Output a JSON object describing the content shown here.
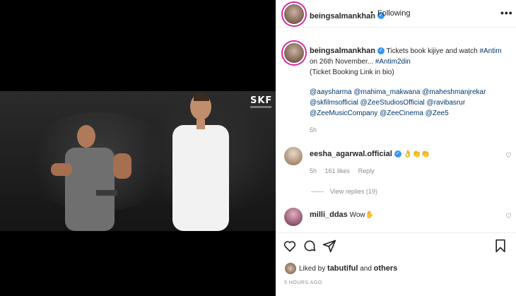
{
  "post": {
    "username": "beingsalmankhan",
    "following_label": "Following",
    "more_label": "•••",
    "caption_text": "Tickets book kijiye and watch ",
    "caption_tag1": "#Antim",
    "caption_mid": " on 26th November... ",
    "caption_tag2": "#Antim2din",
    "caption_line2": "(Ticket Booking Link in bio)",
    "mentions_line1": "@aaysharma @mahima_makwana @maheshmanjrekar",
    "mentions_line2": "@skfilmsofficial @ZeeStudiosOfficial @ravibasrur",
    "mentions_line3": "@ZeeMusicCompany @ZeeCinema @Zee5",
    "caption_time": "5h",
    "video_logo": "SKF"
  },
  "comments": [
    {
      "username": "eesha_agarwal.official",
      "text": "👌👏👏",
      "time": "5h",
      "likes": "161 likes",
      "reply_label": "Reply",
      "view_replies": "View replies (19)"
    },
    {
      "username": "milli_ddas",
      "text": "Wow✋"
    }
  ],
  "likes": {
    "prefix": "Liked by ",
    "user": "tabutiful",
    "conj": " and ",
    "others": "others"
  },
  "timestamp": "5 HOURS AGO",
  "colors": {
    "link": "#00376b",
    "muted": "#8e8e8e",
    "verified": "#3897f0"
  }
}
